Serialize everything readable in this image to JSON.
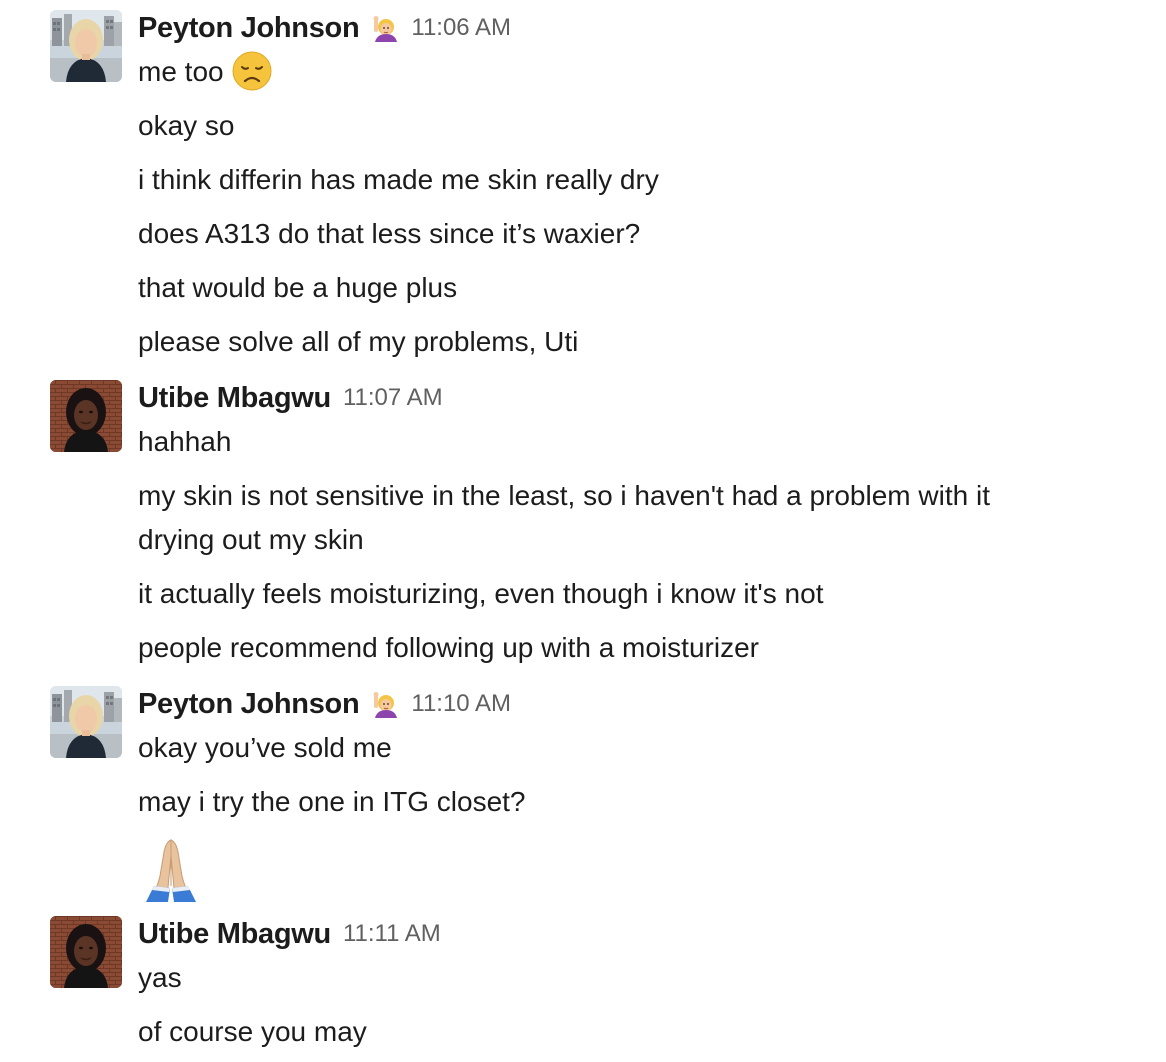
{
  "messages": [
    {
      "author": "Peyton Johnson",
      "status_emoji": "raising-hand-woman-emoji",
      "time": "11:06 AM",
      "lines": [
        "me too",
        "okay so",
        "i think differin has made me skin really dry",
        "does A313 do that less since it’s waxier?",
        "that would be a huge plus",
        "please solve all of my problems, Uti"
      ],
      "line_emoji": "disappointed-face-emoji"
    },
    {
      "author": "Utibe Mbagwu",
      "time": "11:07 AM",
      "lines": [
        "hahhah",
        "my skin is not sensitive in the least, so i haven't had a problem with it drying out my skin",
        "it actually feels moisturizing, even though i know it's not",
        "people recommend following up with a moisturizer"
      ]
    },
    {
      "author": "Peyton Johnson",
      "status_emoji": "raising-hand-woman-emoji",
      "time": "11:10 AM",
      "lines": [
        "okay you’ve sold me",
        "may i try the one in ITG closet?"
      ],
      "big_emoji": "folded-hands-emoji"
    },
    {
      "author": "Utibe Mbagwu",
      "time": "11:11 AM",
      "lines": [
        "yas",
        "of course you may"
      ]
    }
  ],
  "colors": {
    "text": "#1d1c1d",
    "timestamp": "#616061"
  }
}
